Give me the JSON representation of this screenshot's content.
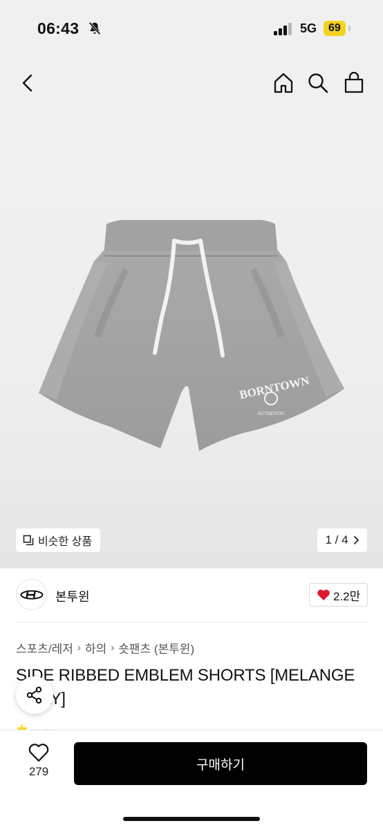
{
  "status_bar": {
    "time": "06:43",
    "network": "5G",
    "battery": "69",
    "battery_color": "#f4d21f"
  },
  "nav": {
    "back_icon": "chevron-left-icon",
    "home_icon": "home-icon",
    "search_icon": "search-icon",
    "cart_icon": "shopping-bag-icon"
  },
  "gallery": {
    "similar_label": "비슷한 상품",
    "pager": "1 / 4",
    "image_icon": "product-shorts-image",
    "print_main": "BORNTOWN",
    "print_sub": "AUTHENTIC"
  },
  "brand": {
    "name": "본투윈",
    "like_count": "2.2만",
    "heart_color": "#e0192a"
  },
  "breadcrumb": {
    "items": [
      "스포츠/레저",
      "하의",
      "숏팬츠 (본투윈)"
    ]
  },
  "product": {
    "title": "SIDE RIBBED EMBLEM SHORTS [MELANGE GRAY]"
  },
  "bottom_bar": {
    "wish_count": "279",
    "buy_label": "구매하기"
  }
}
